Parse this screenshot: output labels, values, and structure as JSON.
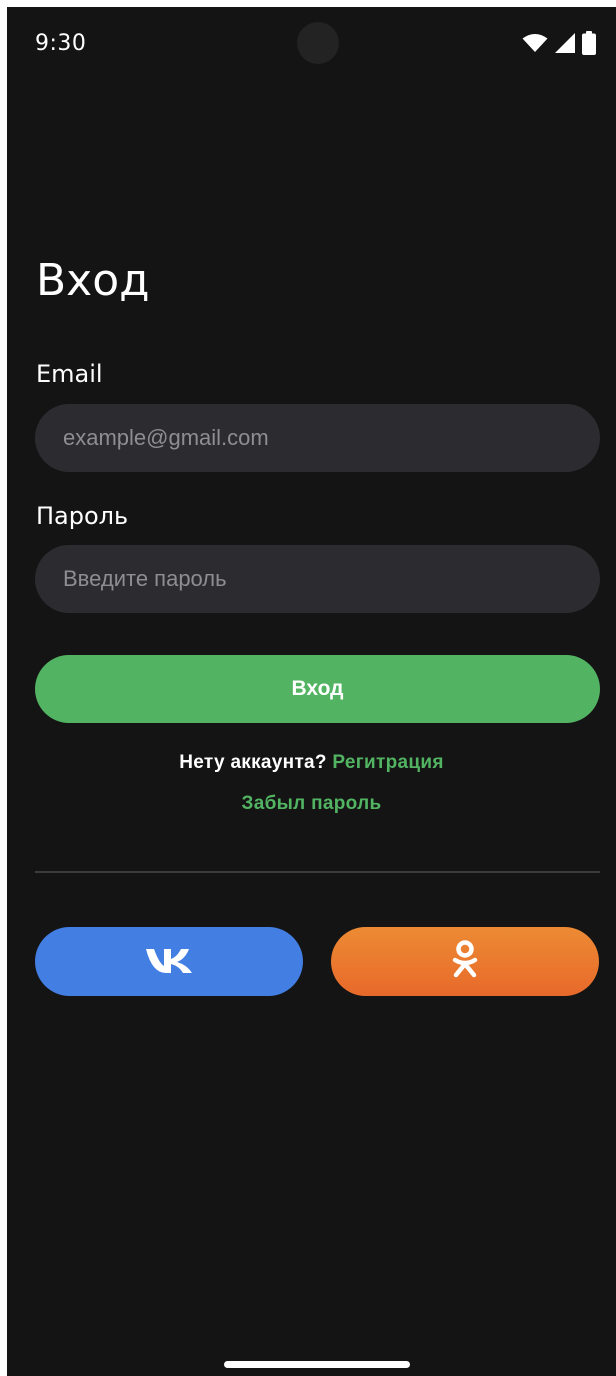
{
  "status_bar": {
    "time": "9:30",
    "icons": [
      "wifi-icon",
      "signal-icon",
      "battery-icon"
    ]
  },
  "login": {
    "title": "Вход",
    "email_label": "Email",
    "email_placeholder": "example@gmail.com",
    "email_value": "",
    "password_label": "Пароль",
    "password_placeholder": "Введите пароль",
    "password_value": "",
    "submit_label": "Вход",
    "no_account_text": "Нету аккаунта?",
    "register_link": "Регитрация",
    "forgot_password_link": "Забыл пароль"
  },
  "social": {
    "vk_icon": "vk-logo-icon",
    "ok_icon": "odnoklassniki-logo-icon"
  },
  "colors": {
    "background": "#141414",
    "input_background": "#2c2c30",
    "accent_green": "#52b462",
    "vk_blue": "#437ee3",
    "ok_orange": "#ec7a30",
    "text_primary": "#ffffff",
    "placeholder": "#8e8e92"
  }
}
